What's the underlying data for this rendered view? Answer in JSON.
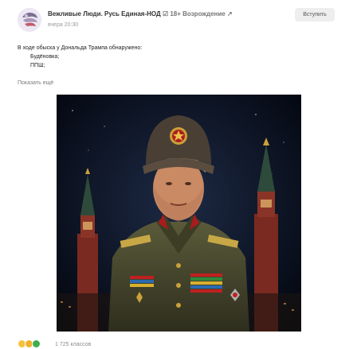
{
  "post": {
    "author": "Вежливые Люди. Русь Единая-НОД",
    "badges": "☑ 18+ Возрождение ↗",
    "time": "вчера 20:30",
    "join_label": "Вступить",
    "text_lines": [
      "В ходе обыска у Дональда Трампа обнаружено:",
      "Будёновка;",
      "ППШ;"
    ],
    "show_more": "Показать ещё",
    "likes": "1 725 классов"
  },
  "icons": [
    "group-avatar-icon",
    "verified-check-icon",
    "emoji-laugh-icon",
    "emoji-smile-icon",
    "emoji-green-icon"
  ],
  "colors": {
    "join_bg": "#eeeeee",
    "link_gray": "#7a7a7a",
    "image_bg": "#060a1a"
  }
}
